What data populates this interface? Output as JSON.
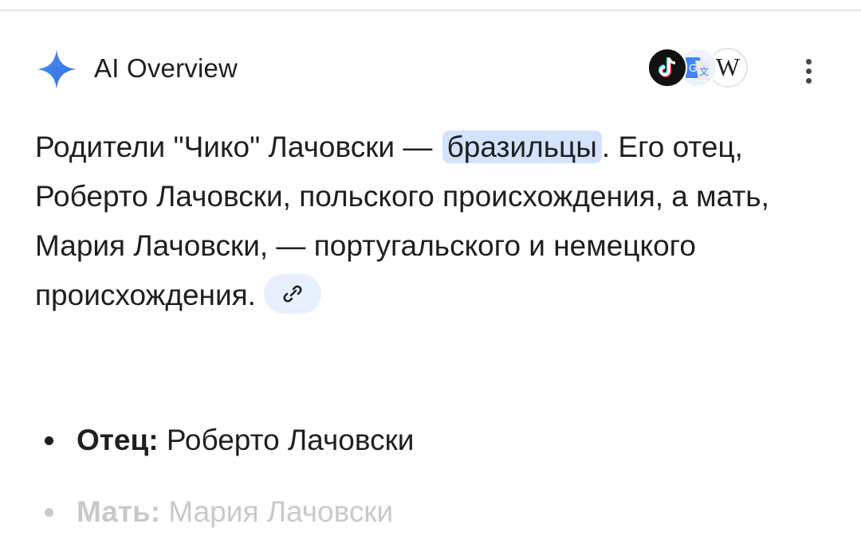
{
  "header": {
    "title": "AI Overview",
    "sources": [
      {
        "name": "tiktok-source-icon"
      },
      {
        "name": "translate-source-icon"
      },
      {
        "name": "wikipedia-source-icon",
        "glyph": "W"
      }
    ]
  },
  "overview": {
    "part1": "Родители \"Чико\" Лачовски — ",
    "highlight": "бразильцы",
    "part2": ". Его отец, Роберто Лачовски, польского происхождения, а мать, Мария Лачовски, — португальского и немецкого происхождения."
  },
  "list": [
    {
      "label": "Отец:",
      "value": " Роберто Лачовски"
    },
    {
      "label": "Мать:",
      "value": " Мария Лачовски"
    }
  ],
  "colors": {
    "spark": "#4285f4",
    "highlight": "#d3e3fd",
    "chip": "#e8f0fe"
  }
}
